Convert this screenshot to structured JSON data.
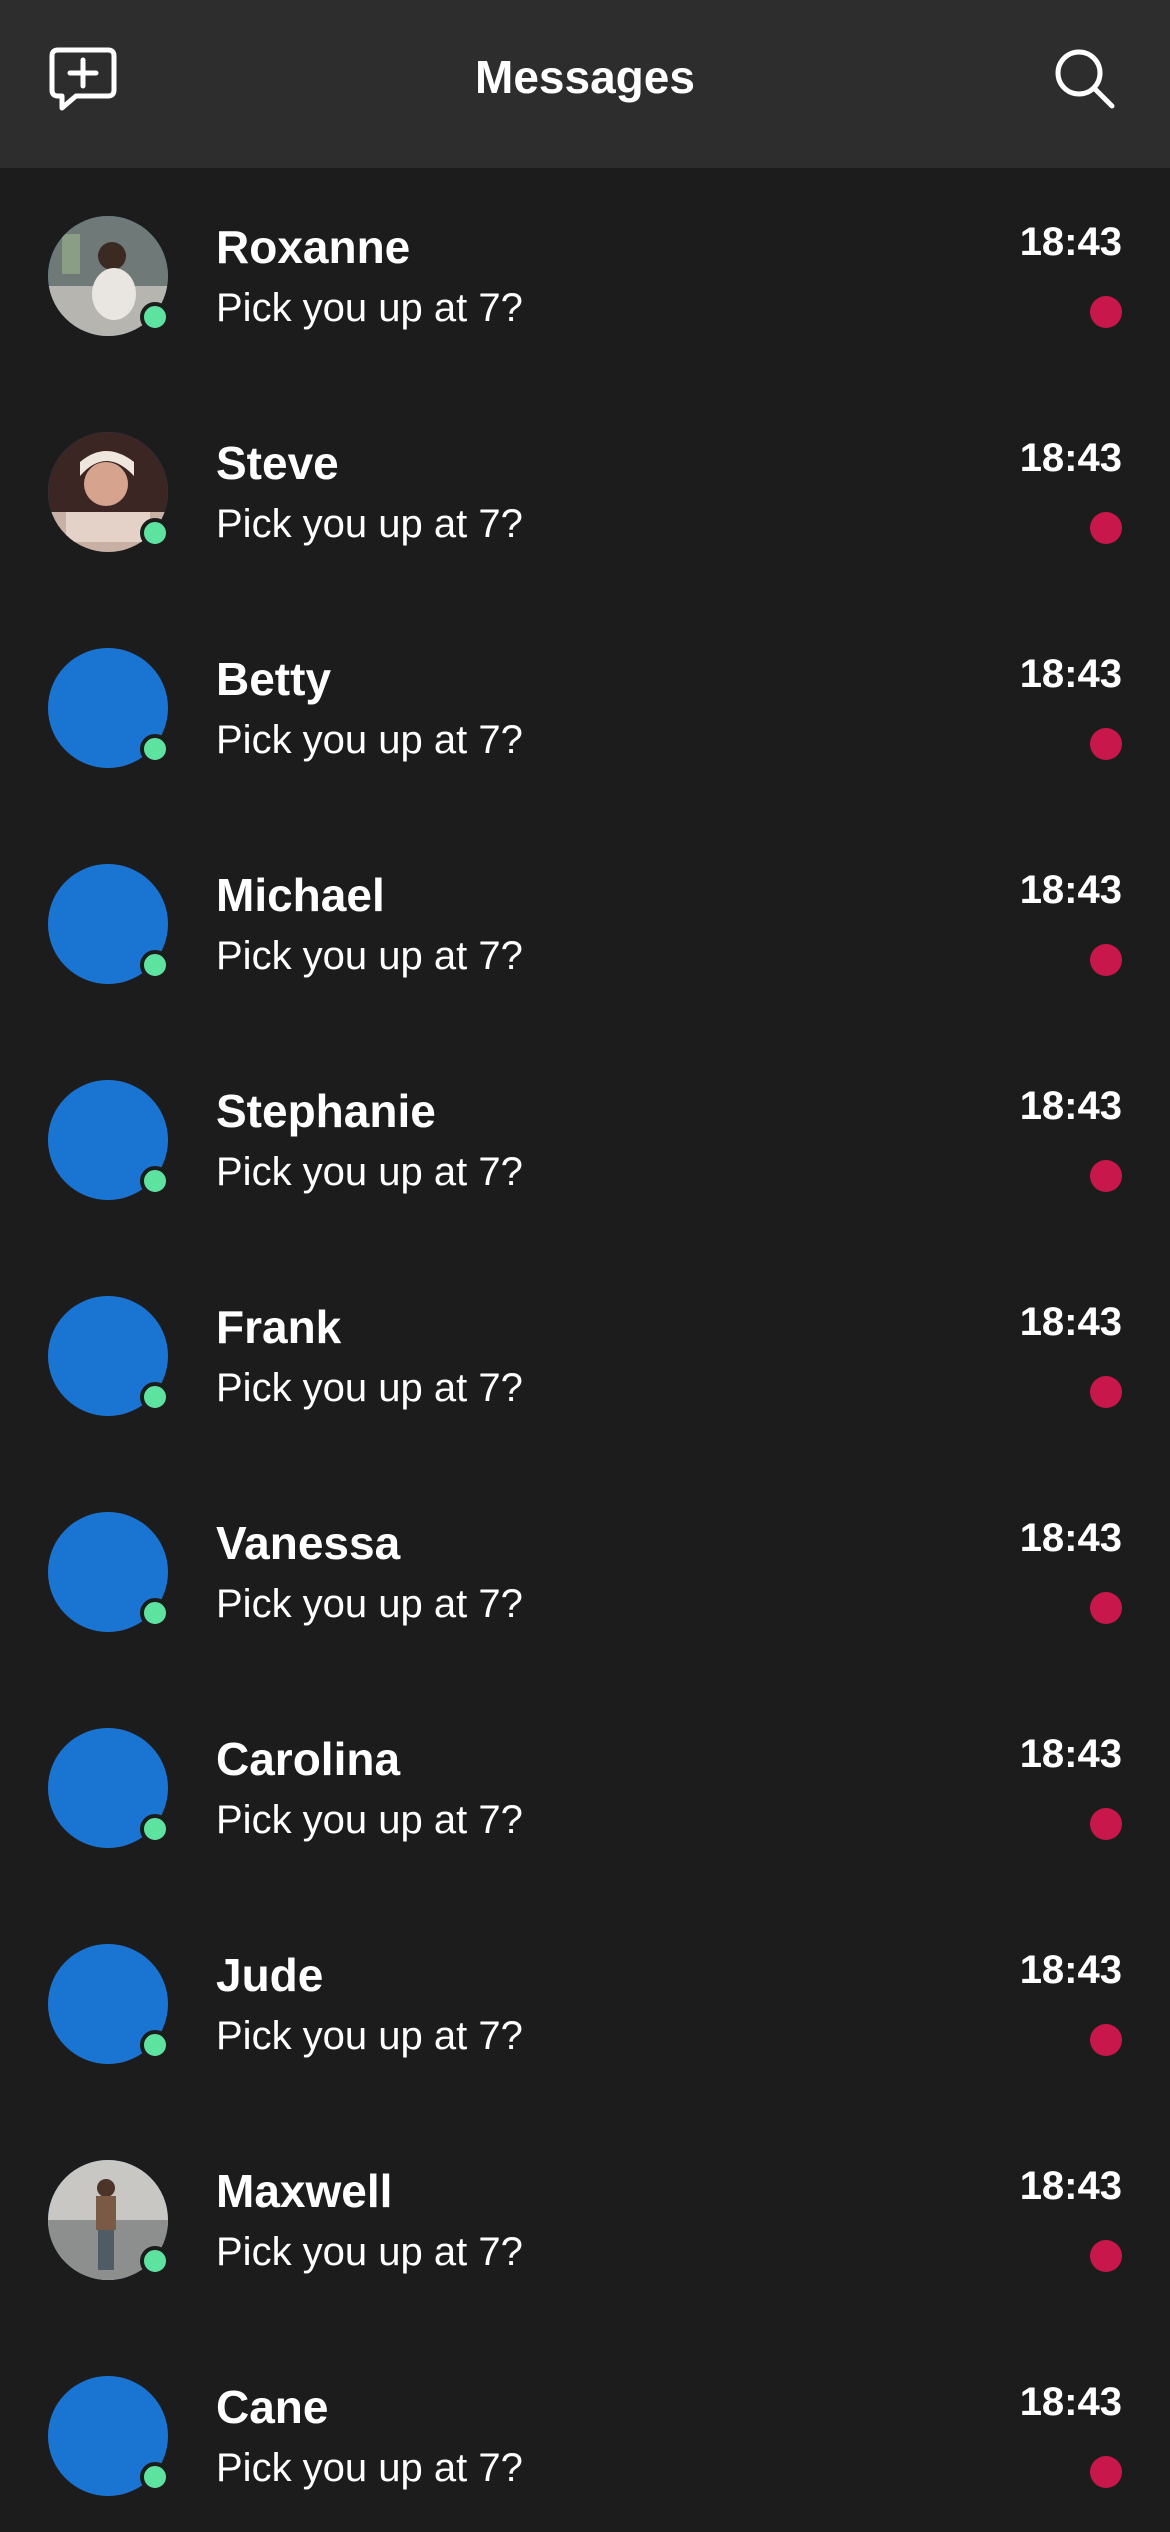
{
  "header": {
    "title": "Messages",
    "compose_icon": "message-plus-icon",
    "search_icon": "search-icon"
  },
  "colors": {
    "header_bg": "#2e2d2e",
    "background": "#1c1c1d",
    "avatar_placeholder": "#1a75d2",
    "online_dot": "#5ee2a0",
    "unread_dot": "#c8184b"
  },
  "conversations": [
    {
      "name": "Roxanne",
      "preview": "Pick you up at 7?",
      "time": "18:43",
      "avatar": "photo",
      "online": true,
      "unread": true
    },
    {
      "name": "Steve",
      "preview": "Pick you up at 7?",
      "time": "18:43",
      "avatar": "photo",
      "online": true,
      "unread": true
    },
    {
      "name": "Betty",
      "preview": "Pick you up at 7?",
      "time": "18:43",
      "avatar": "placeholder",
      "online": true,
      "unread": true
    },
    {
      "name": "Michael",
      "preview": "Pick you up at 7?",
      "time": "18:43",
      "avatar": "placeholder",
      "online": true,
      "unread": true
    },
    {
      "name": "Stephanie",
      "preview": "Pick you up at 7?",
      "time": "18:43",
      "avatar": "placeholder",
      "online": true,
      "unread": true
    },
    {
      "name": "Frank",
      "preview": "Pick you up at 7?",
      "time": "18:43",
      "avatar": "placeholder",
      "online": true,
      "unread": true
    },
    {
      "name": "Vanessa",
      "preview": "Pick you up at 7?",
      "time": "18:43",
      "avatar": "placeholder",
      "online": true,
      "unread": true
    },
    {
      "name": "Carolina",
      "preview": "Pick you up at 7?",
      "time": "18:43",
      "avatar": "placeholder",
      "online": true,
      "unread": true
    },
    {
      "name": "Jude",
      "preview": "Pick you up at 7?",
      "time": "18:43",
      "avatar": "placeholder",
      "online": true,
      "unread": true
    },
    {
      "name": "Maxwell",
      "preview": "Pick you up at 7?",
      "time": "18:43",
      "avatar": "photo",
      "online": true,
      "unread": true
    },
    {
      "name": "Cane",
      "preview": "Pick you up at 7?",
      "time": "18:43",
      "avatar": "placeholder",
      "online": true,
      "unread": true
    }
  ]
}
